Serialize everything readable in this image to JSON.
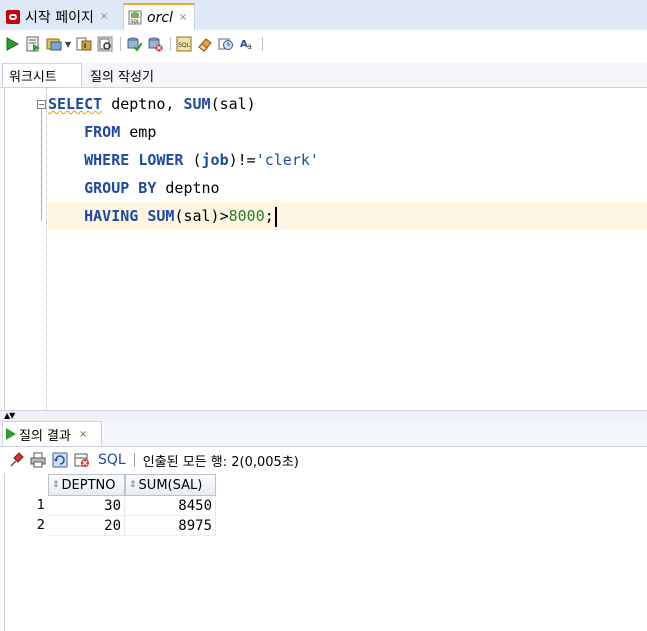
{
  "doc_tabs": [
    {
      "label": "시작 페이지",
      "close": "×"
    },
    {
      "label": "orcl",
      "close": "×"
    }
  ],
  "sub_tabs": [
    "워크시트",
    "질의 작성기"
  ],
  "editor": {
    "lines": [
      [
        {
          "t": "kw sq",
          "v": "SELECT"
        },
        {
          "t": "id",
          "v": " deptno, "
        },
        {
          "t": "kw",
          "v": "SUM"
        },
        {
          "t": "id",
          "v": "(sal)"
        }
      ],
      [
        {
          "t": "id",
          "v": "    "
        },
        {
          "t": "kw",
          "v": "FROM"
        },
        {
          "t": "id",
          "v": " emp"
        }
      ],
      [
        {
          "t": "id",
          "v": "    "
        },
        {
          "t": "kw",
          "v": "WHERE"
        },
        {
          "t": "id",
          "v": " "
        },
        {
          "t": "kw",
          "v": "LOWER"
        },
        {
          "t": "id",
          "v": " ("
        },
        {
          "t": "kw",
          "v": "job"
        },
        {
          "t": "id",
          "v": ")!="
        },
        {
          "t": "str",
          "v": "'clerk'"
        }
      ],
      [
        {
          "t": "id",
          "v": "    "
        },
        {
          "t": "kw",
          "v": "GROUP BY"
        },
        {
          "t": "id",
          "v": " deptno"
        }
      ],
      [
        {
          "t": "id",
          "v": "    "
        },
        {
          "t": "kw",
          "v": "HAVING"
        },
        {
          "t": "id",
          "v": " "
        },
        {
          "t": "kw",
          "v": "SUM"
        },
        {
          "t": "id",
          "v": "(sal)>"
        },
        {
          "t": "num",
          "v": "8000"
        },
        {
          "t": "id",
          "v": ";"
        }
      ]
    ]
  },
  "results": {
    "tab_label": "질의 결과",
    "tab_close": "×",
    "sql_link": "SQL",
    "status": "인출된 모든 행: 2(0,005초)",
    "columns": [
      "DEPTNO",
      "SUM(SAL)"
    ],
    "rows": [
      {
        "num": "1",
        "cells": [
          "30",
          "8450"
        ]
      },
      {
        "num": "2",
        "cells": [
          "20",
          "8975"
        ]
      }
    ]
  },
  "colors": {
    "keyword": "#1f4aa0",
    "number": "#2a7d2a",
    "current_line": "#fdf6e3",
    "run": "#2a9d2a"
  }
}
